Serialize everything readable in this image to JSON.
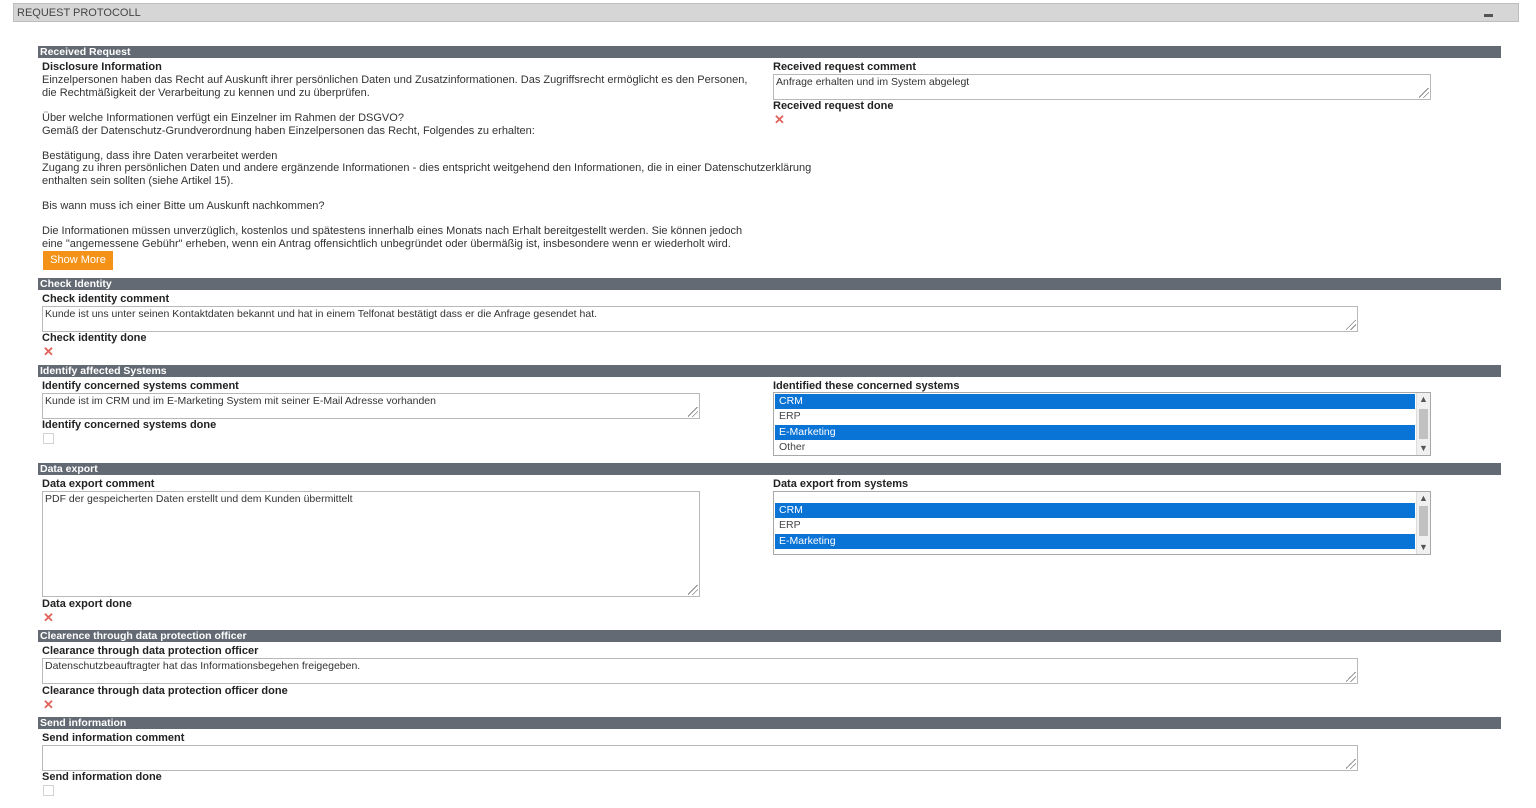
{
  "header": {
    "title": "REQUEST PROTOCOLL",
    "collapse_icon": "minus-icon"
  },
  "received": {
    "section_title": "Received Request",
    "disclosure_label": "Disclosure Information",
    "disclosure_lines": [
      "Einzelpersonen haben das Recht auf Auskunft ihrer persönlichen Daten und Zusatzinformationen. Das Zugriffsrecht ermöglicht es den Personen,",
      "die Rechtmäßigkeit der Verarbeitung zu kennen und zu überprüfen.",
      "Über welche Informationen verfügt ein Einzelner im Rahmen der DSGVO?",
      "Gemäß der Datenschutz-Grundverordnung haben Einzelpersonen das Recht, Folgendes zu erhalten:",
      "Bestätigung, dass ihre Daten verarbeitet werden",
      "Zugang zu ihren persönlichen Daten und andere ergänzende Informationen - dies entspricht weitgehend den Informationen, die in einer Datenschutzerklärung",
      "enthalten sein sollten (siehe Artikel 15).",
      "Bis wann muss ich einer Bitte um Auskunft nachkommen?",
      "Die Informationen müssen unverzüglich, kostenlos und spätestens innerhalb eines Monats nach Erhalt bereitgestellt werden. Sie können jedoch",
      "eine \"angemessene Gebühr\" erheben, wenn ein Antrag offensichtlich unbegründet oder übermäßig ist, insbesondere wenn er wiederholt wird."
    ],
    "show_more": "Show More",
    "comment_label": "Received request comment",
    "comment_value": "Anfrage erhalten und im System abgelegt",
    "done_label": "Received request done",
    "done_state": "x"
  },
  "identity": {
    "section_title": "Check Identity",
    "comment_label": "Check identity comment",
    "comment_value": "Kunde ist uns unter seinen Kontaktdaten bekannt und hat in einem Telfonat bestätigt dass er die Anfrage gesendet hat.",
    "done_label": "Check identity done",
    "done_state": "x"
  },
  "systems": {
    "section_title": "Identify affected Systems",
    "comment_label": "Identify concerned systems comment",
    "comment_value": "Kunde ist im CRM und im E-Marketing System mit seiner E-Mail Adresse vorhanden",
    "done_label": "Identify concerned systems done",
    "done_state": "empty",
    "list_label": "Identified these concerned systems",
    "options": [
      {
        "label": "CRM",
        "selected": true
      },
      {
        "label": "ERP",
        "selected": false
      },
      {
        "label": "E-Marketing",
        "selected": true
      },
      {
        "label": "Other",
        "selected": false
      }
    ]
  },
  "export": {
    "section_title": "Data export",
    "comment_label": "Data export comment",
    "comment_value": "PDF der gespeicherten Daten erstellt und dem Kunden übermittelt",
    "done_label": "Data export done",
    "done_state": "x",
    "list_label": "Data export from systems",
    "options": [
      {
        "label": "CRM",
        "selected": true
      },
      {
        "label": "ERP",
        "selected": false
      },
      {
        "label": "E-Marketing",
        "selected": true
      }
    ]
  },
  "clearance": {
    "section_title": "Clearence through data protection officer",
    "comment_label": "Clearance through data protection officer",
    "comment_value": "Datenschutzbeauftragter hat das Informationsbegehen freigegeben.",
    "done_label": "Clearance through data protection officer done",
    "done_state": "x"
  },
  "send": {
    "section_title": "Send information",
    "comment_label": "Send information comment",
    "comment_value": "",
    "done_label": "Send information done",
    "done_state": "empty"
  },
  "icons": {
    "done_x": "cross-icon",
    "resize": "resize-grip-icon",
    "scroll_up": "chevron-up-icon",
    "scroll_down": "chevron-down-icon"
  },
  "colors": {
    "section_bar": "#636a73",
    "selection": "#0a73d6",
    "show_more": "#f39217",
    "cross": "#e0645c"
  }
}
